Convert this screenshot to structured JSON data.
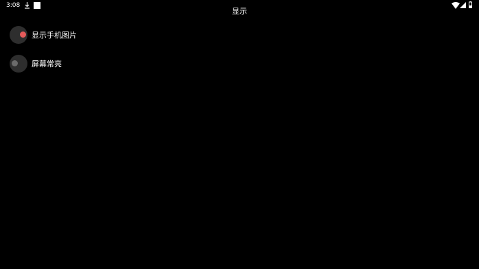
{
  "status_bar": {
    "time": "3:08",
    "icons": [
      "download-icon",
      "notification-square-icon",
      "wifi-icon",
      "signal-icon",
      "battery-icon"
    ]
  },
  "page": {
    "title": "显示"
  },
  "settings": [
    {
      "label": "显示手机图片",
      "enabled": true
    },
    {
      "label": "屏幕常亮",
      "enabled": false
    }
  ],
  "colors": {
    "background": "#000000",
    "switch_on": "#e45a5a",
    "switch_off": "#6b6b6b",
    "switch_track": "#2e2e2e"
  }
}
